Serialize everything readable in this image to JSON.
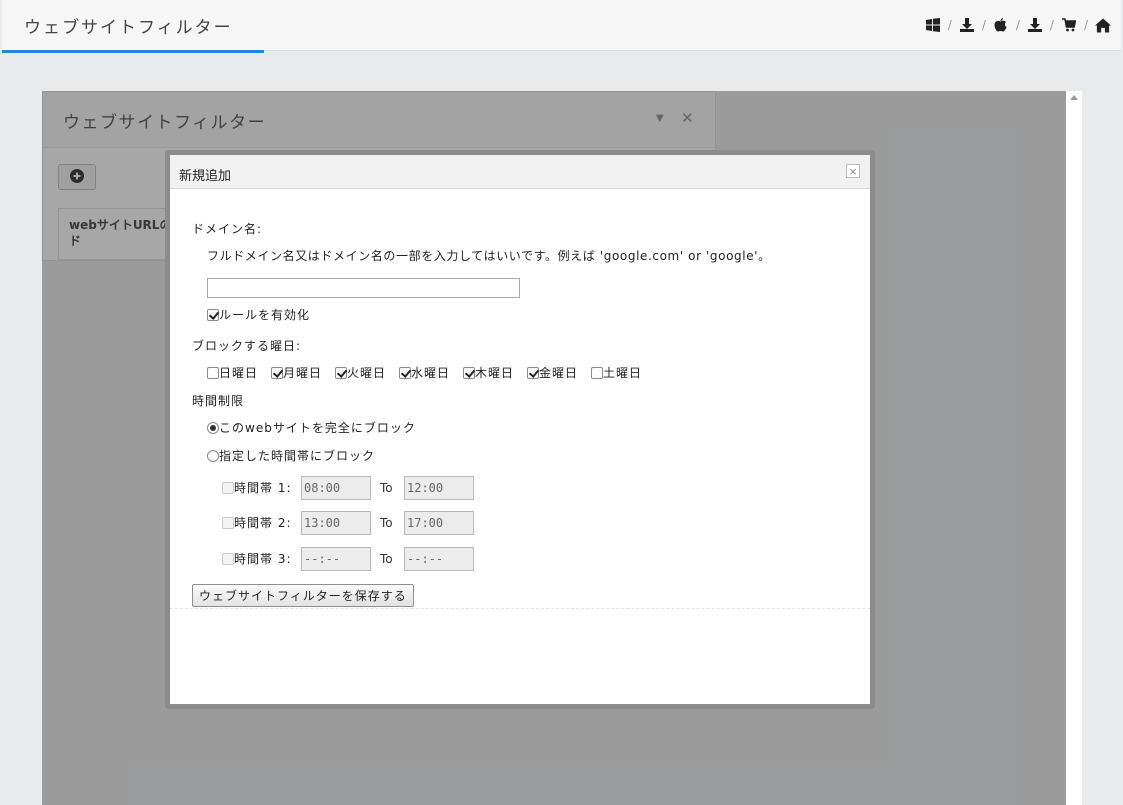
{
  "header": {
    "title": "ウェブサイトフィルター",
    "nav": [
      {
        "icon": "windows-icon",
        "sep": "/"
      },
      {
        "icon": "download-icon",
        "sep": "/"
      },
      {
        "icon": "apple-icon",
        "sep": "/"
      },
      {
        "icon": "download-icon",
        "sep": "/"
      },
      {
        "icon": "cart-icon",
        "sep": "/"
      },
      {
        "icon": "home-icon",
        "sep": ""
      }
    ]
  },
  "panel": {
    "title": "ウェブサイトフィルター",
    "table_header": "webサイトURLの\nド"
  },
  "modal": {
    "title": "新規追加",
    "close_glyph": "×",
    "domain_label": "ドメイン名:",
    "domain_help": "フルドメイン名又はドメイン名の一部を入力してはいいです。例えば 'google.com' or 'google'。",
    "domain_value": "",
    "enable_rule_label": "ルールを有効化",
    "enable_rule_checked": true,
    "block_days_label": "ブロックする曜日:",
    "days": [
      {
        "label": "日曜日",
        "checked": false
      },
      {
        "label": "月曜日",
        "checked": true
      },
      {
        "label": "火曜日",
        "checked": true
      },
      {
        "label": "水曜日",
        "checked": true
      },
      {
        "label": "木曜日",
        "checked": true
      },
      {
        "label": "金曜日",
        "checked": true
      },
      {
        "label": "土曜日",
        "checked": false
      }
    ],
    "time_limit_label": "時間制限",
    "radio_full_block": "このwebサイトを完全にブロック",
    "radio_time_block": "指定した時間帯にブロック",
    "selected_radio": "full",
    "timeslots": [
      {
        "label": "時間帯 1:",
        "from": "08:00",
        "to_label": "To",
        "to": "12:00"
      },
      {
        "label": "時間帯 2:",
        "from": "13:00",
        "to_label": "To",
        "to": "17:00"
      },
      {
        "label": "時間帯 3:",
        "from": "--:--",
        "to_label": "To",
        "to": "--:--"
      }
    ],
    "save_label": "ウェブサイトフィルターを保存する"
  },
  "colors": {
    "accent": "#1e88e5"
  }
}
